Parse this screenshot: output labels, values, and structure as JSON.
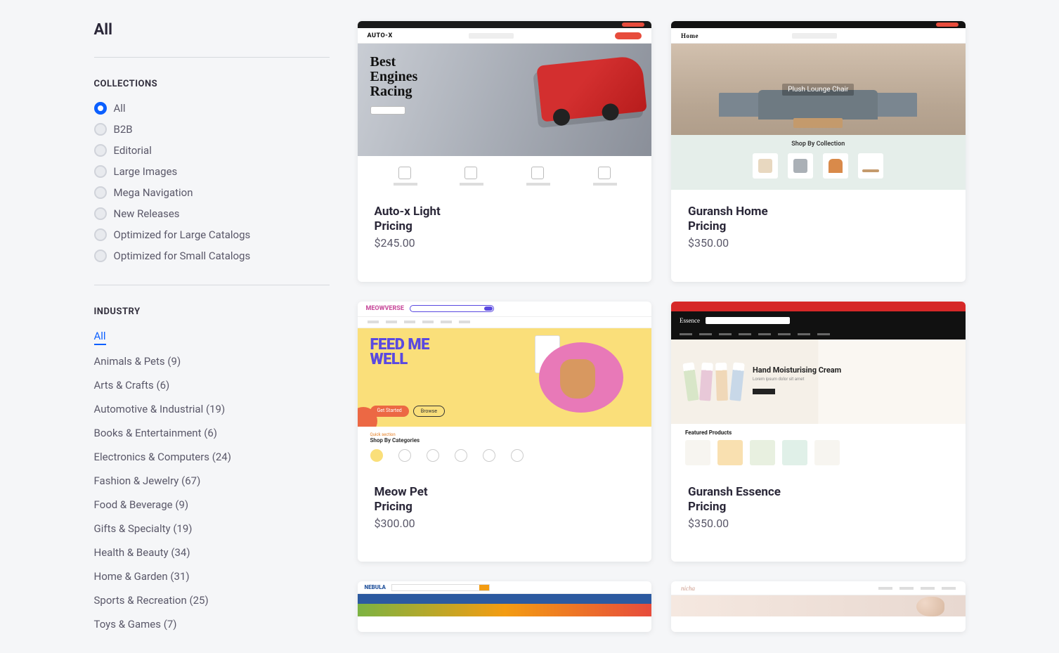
{
  "sidebar": {
    "title": "All",
    "collections": {
      "heading": "COLLECTIONS",
      "options": [
        {
          "label": "All",
          "selected": true
        },
        {
          "label": "B2B",
          "selected": false
        },
        {
          "label": "Editorial",
          "selected": false
        },
        {
          "label": "Large Images",
          "selected": false
        },
        {
          "label": "Mega Navigation",
          "selected": false
        },
        {
          "label": "New Releases",
          "selected": false
        },
        {
          "label": "Optimized for Large Catalogs",
          "selected": false
        },
        {
          "label": "Optimized for Small Catalogs",
          "selected": false
        }
      ]
    },
    "industry": {
      "heading": "INDUSTRY",
      "items": [
        {
          "label": "All",
          "active": true
        },
        {
          "label": "Animals & Pets (9)",
          "active": false
        },
        {
          "label": "Arts & Crafts (6)",
          "active": false
        },
        {
          "label": "Automotive & Industrial (19)",
          "active": false
        },
        {
          "label": "Books & Entertainment (6)",
          "active": false
        },
        {
          "label": "Electronics & Computers (24)",
          "active": false
        },
        {
          "label": "Fashion & Jewelry (67)",
          "active": false
        },
        {
          "label": "Food & Beverage (9)",
          "active": false
        },
        {
          "label": "Gifts & Specialty (19)",
          "active": false
        },
        {
          "label": "Health & Beauty (34)",
          "active": false
        },
        {
          "label": "Home & Garden (31)",
          "active": false
        },
        {
          "label": "Sports & Recreation (25)",
          "active": false
        },
        {
          "label": "Toys & Games (7)",
          "active": false
        }
      ]
    }
  },
  "cards": [
    {
      "title": "Auto-x Light",
      "subtitle": "Pricing",
      "price": "$245.00",
      "thumb": {
        "logo": "AUTO-X",
        "headline": "Best\nEngines\nRacing"
      }
    },
    {
      "title": "Guransh Home",
      "subtitle": "Pricing",
      "price": "$350.00",
      "thumb": {
        "logo": "Home",
        "hero_label": "Plush Lounge Chair",
        "section": "Shop By Collection"
      }
    },
    {
      "title": "Meow Pet",
      "subtitle": "Pricing",
      "price": "$300.00",
      "thumb": {
        "logo": "MEOWVERSE",
        "headline": "FEED ME\nWELL",
        "btn1": "Get Started",
        "btn2": "Browse",
        "quick": "Quick section",
        "section": "Shop By Categories"
      }
    },
    {
      "title": "Guransh Essence",
      "subtitle": "Pricing",
      "price": "$350.00",
      "thumb": {
        "logo": "Essence",
        "headline": "Hand Moisturising Cream",
        "section": "Featured Products"
      }
    },
    {
      "title": "",
      "subtitle": "",
      "price": "",
      "thumb": {
        "logo": "NEBULA"
      }
    },
    {
      "title": "",
      "subtitle": "",
      "price": "",
      "thumb": {
        "logo": "nicha"
      }
    }
  ]
}
